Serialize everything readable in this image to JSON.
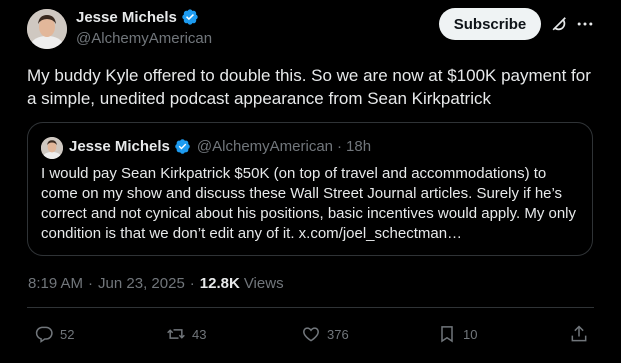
{
  "author": {
    "name": "Jesse Michels",
    "handle": "@AlchemyAmerican",
    "avatar_icon": "person-avatar",
    "verified_color": "#1d9bf0"
  },
  "header_actions": {
    "subscribe_label": "Subscribe",
    "grok_icon": "grok-icon",
    "more_icon": "more-icon"
  },
  "tweet": {
    "text": "My buddy Kyle offered to double this. So we are now at $100K payment for a simple, unedited podcast appearance from Sean Kirkpatrick"
  },
  "quote": {
    "name": "Jesse Michels",
    "handle": "@AlchemyAmerican",
    "separator": "·",
    "time": "18h",
    "text": "I would pay Sean Kirkpatrick $50K (on top of travel and accommodations) to come on my show and discuss these Wall Street Journal articles. Surely if he’s correct and not cynical about his positions, basic incentives would apply. My only condition is that we don’t edit any of it. x.com/joel_schectman…"
  },
  "meta": {
    "time": "8:19 AM",
    "separator1": "·",
    "date": "Jun 23, 2025",
    "separator2": "·",
    "views_count": "12.8K",
    "views_label": "Views"
  },
  "actions": {
    "replies": "52",
    "reposts": "43",
    "likes": "376",
    "bookmarks": "10"
  }
}
